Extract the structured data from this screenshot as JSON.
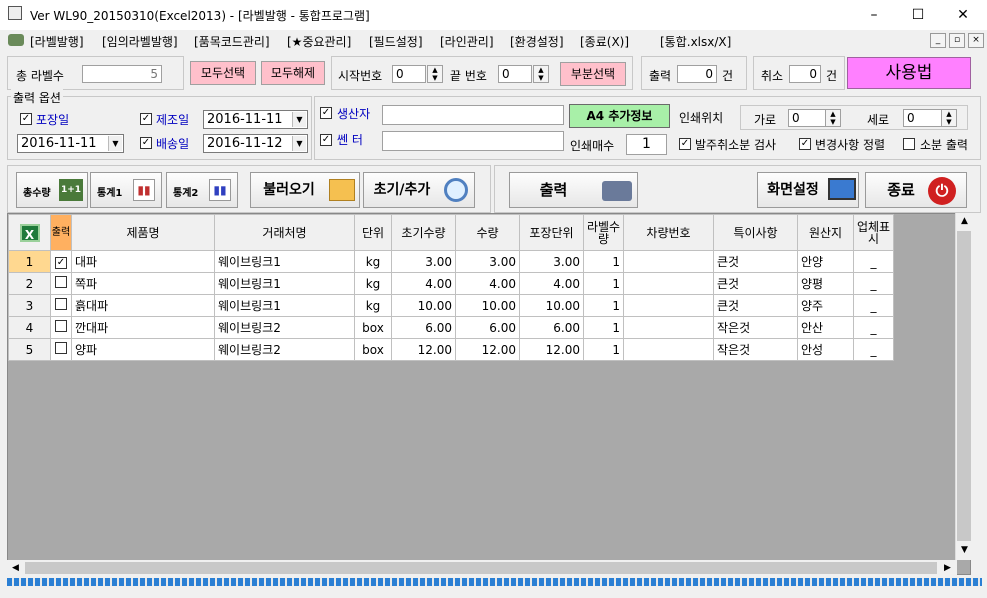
{
  "window": {
    "title": "Ver WL90_20150310(Excel2013) - [라벨발행 - 통합프로그램]",
    "minimize": "–",
    "maximize": "☐",
    "close": "✕"
  },
  "menu": {
    "items": [
      "[라벨발행]",
      "[임의라벨발행]",
      "[품목코드관리]",
      "[★중요관리]",
      "[필드설정]",
      "[라인관리]",
      "[환경설정]",
      "[종료(X)]",
      "[통합.xlsx/X]"
    ]
  },
  "top": {
    "total_label": "총 라벨수",
    "total_value": "5",
    "select_all": "모두선택",
    "deselect_all": "모두해제",
    "start_no_label": "시작번호",
    "start_no_value": "0",
    "end_no_label": "끝 번호",
    "end_no_value": "0",
    "partial_select": "부분선택",
    "print_label": "출력",
    "print_value": "0",
    "unit_gun": "건",
    "cancel_label": "취소",
    "cancel_value": "0",
    "usage_button": "사용법"
  },
  "options": {
    "group_title": "출력 옵션",
    "packing_date": {
      "label": "포장일",
      "checked": true,
      "value": "2016-11-11"
    },
    "mfg_date": {
      "label": "제조일",
      "checked": true,
      "value": "2016-11-11"
    },
    "ship_date": {
      "label": "배송일",
      "checked": true,
      "value": "2016-11-12"
    },
    "producer": {
      "label": "생산자",
      "checked": true,
      "value": ""
    },
    "center": {
      "label": "쎈 터",
      "checked": true,
      "value": ""
    },
    "a4_info": "A4 추가정보",
    "print_position": "인쇄위치",
    "horizontal_label": "가로",
    "horizontal_value": "0",
    "vertical_label": "세로",
    "vertical_value": "0",
    "copies_label": "인쇄매수",
    "copies_value": "1",
    "order_cancel_check": {
      "label": "발주취소분 검사",
      "checked": true
    },
    "change_sort": {
      "label": "변경사항 정렬",
      "checked": true
    },
    "small_print": {
      "label": "소분 출력",
      "checked": false
    }
  },
  "toolbar": {
    "total_qty": "총수량",
    "stats1": "통계1",
    "stats2": "통계2",
    "load": "불러오기",
    "reset_add": "초기/추가",
    "print": "출력",
    "screen_settings": "화면설정",
    "exit": "종료"
  },
  "grid": {
    "headers": [
      "출력",
      "제품명",
      "거래처명",
      "단위",
      "초기수량",
      "수량",
      "포장단위",
      "라벨수량",
      "차량번호",
      "특이사항",
      "원산지",
      "업체표시"
    ],
    "rows": [
      {
        "no": "1",
        "checked": true,
        "product": "대파",
        "customer": "웨이브링크1",
        "unit": "kg",
        "init_qty": "3.00",
        "qty": "3.00",
        "pack_unit": "3.00",
        "label_qty": "1",
        "car_no": "",
        "note": "큰것",
        "origin": "안양",
        "company": "_"
      },
      {
        "no": "2",
        "checked": false,
        "product": "쪽파",
        "customer": "웨이브링크1",
        "unit": "kg",
        "init_qty": "4.00",
        "qty": "4.00",
        "pack_unit": "4.00",
        "label_qty": "1",
        "car_no": "",
        "note": "큰것",
        "origin": "양평",
        "company": "_"
      },
      {
        "no": "3",
        "checked": false,
        "product": "흙대파",
        "customer": "웨이브링크1",
        "unit": "kg",
        "init_qty": "10.00",
        "qty": "10.00",
        "pack_unit": "10.00",
        "label_qty": "1",
        "car_no": "",
        "note": "큰것",
        "origin": "양주",
        "company": "_"
      },
      {
        "no": "4",
        "checked": false,
        "product": "깐대파",
        "customer": "웨이브링크2",
        "unit": "box",
        "init_qty": "6.00",
        "qty": "6.00",
        "pack_unit": "6.00",
        "label_qty": "1",
        "car_no": "",
        "note": "작은것",
        "origin": "안산",
        "company": "_"
      },
      {
        "no": "5",
        "checked": false,
        "product": "양파",
        "customer": "웨이브링크2",
        "unit": "box",
        "init_qty": "12.00",
        "qty": "12.00",
        "pack_unit": "12.00",
        "label_qty": "1",
        "car_no": "",
        "note": "작은것",
        "origin": "안성",
        "company": "_"
      }
    ]
  },
  "colors": {
    "pink_button": "#ffc0cb",
    "usage_button": "#ff80ff",
    "green_button": "#a8f0a8",
    "blue_label": "#0000c0",
    "header_orange": "#ffb060",
    "status_blue": "#2a7fd4"
  }
}
